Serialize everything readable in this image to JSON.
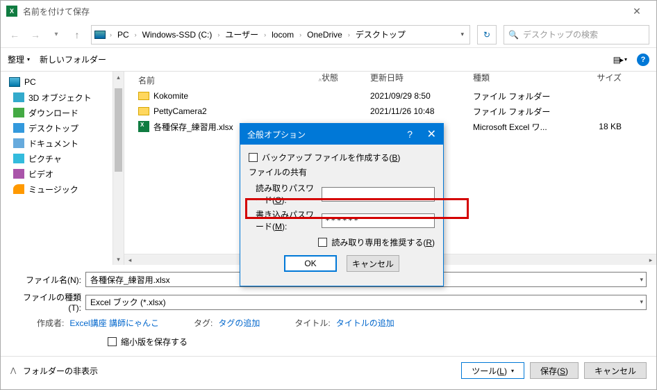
{
  "title": "名前を付けて保存",
  "breadcrumb": [
    "PC",
    "Windows-SSD (C:)",
    "ユーザー",
    "locom",
    "OneDrive",
    "デスクトップ"
  ],
  "search_placeholder": "デスクトップの検索",
  "toolbar": {
    "organize": "整理",
    "new_folder": "新しいフォルダー"
  },
  "columns": {
    "name": "名前",
    "status": "状態",
    "date": "更新日時",
    "type": "種類",
    "size": "サイズ"
  },
  "tree": [
    {
      "label": "PC",
      "icon": "pc"
    },
    {
      "label": "3D オブジェクト",
      "icon": "3d"
    },
    {
      "label": "ダウンロード",
      "icon": "dl"
    },
    {
      "label": "デスクトップ",
      "icon": "desk"
    },
    {
      "label": "ドキュメント",
      "icon": "doc"
    },
    {
      "label": "ピクチャ",
      "icon": "pic"
    },
    {
      "label": "ビデオ",
      "icon": "vid"
    },
    {
      "label": "ミュージック",
      "icon": "mus"
    }
  ],
  "files": [
    {
      "name": "Kokomite",
      "date": "2021/09/29 8:50",
      "type": "ファイル フォルダー",
      "size": "",
      "kind": "folder"
    },
    {
      "name": "PettyCamera2",
      "date": "2021/11/26 10:48",
      "type": "ファイル フォルダー",
      "size": "",
      "kind": "folder"
    },
    {
      "name": "各種保存_練習用.xlsx",
      "date": "",
      "type": "Microsoft Excel ワ...",
      "size": "18 KB",
      "kind": "xlsx"
    }
  ],
  "form": {
    "filename_label": "ファイル名(N):",
    "filename_value": "各種保存_練習用.xlsx",
    "filetype_label": "ファイルの種類(T):",
    "filetype_value": "Excel ブック (*.xlsx)",
    "author_label": "作成者:",
    "author_value": "Excel講座 講師にゃんこ",
    "tag_label": "タグ:",
    "tag_value": "タグの追加",
    "title_label": "タイトル:",
    "title_value": "タイトルの追加",
    "thumbnail": "縮小版を保存する"
  },
  "footer": {
    "hide_folders": "フォルダーの非表示",
    "tools": "ツール(L)",
    "save": "保存(S)",
    "cancel": "キャンセル"
  },
  "popup": {
    "title": "全般オプション",
    "backup": "バックアップ ファイルを作成する(B)",
    "share": "ファイルの共有",
    "read_pw_label": "読み取りパスワード(O):",
    "read_pw_value": "",
    "write_pw_label": "書き込みパスワード(M):",
    "write_pw_value": "******",
    "readonly_rec": "読み取り専用を推奨する(R)",
    "ok": "OK",
    "cancel": "キャンセル"
  }
}
